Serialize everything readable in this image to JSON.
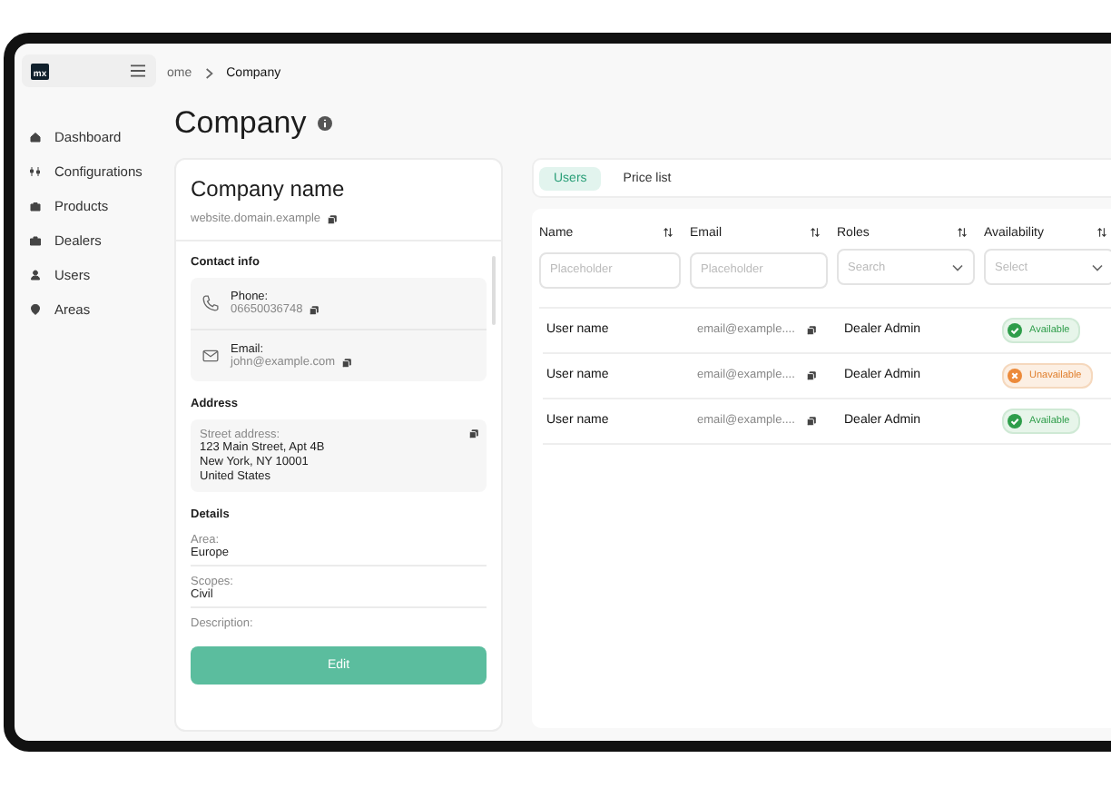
{
  "sidebar": {
    "logo": "mx",
    "items": [
      {
        "label": "Dashboard",
        "kind": "home"
      },
      {
        "label": "Configurations",
        "kind": "sliders"
      },
      {
        "label": "Products",
        "kind": "bag"
      },
      {
        "label": "Dealers",
        "kind": "briefcase"
      },
      {
        "label": "Users",
        "kind": "person"
      },
      {
        "label": "Areas",
        "kind": "pin"
      }
    ]
  },
  "breadcrumb": [
    "ome",
    "Company"
  ],
  "page_title": "Company",
  "company": {
    "name": "Company name",
    "website": "website.domain.example",
    "contact_title": "Contact info",
    "contacts": [
      {
        "kind": "phone",
        "label": "Phone:",
        "value": "06650036748"
      },
      {
        "kind": "email",
        "label": "Email:",
        "value": "john@example.com"
      }
    ],
    "address_title": "Address",
    "address_label": "Street address:",
    "address_lines": [
      "123 Main Street, Apt 4B",
      "New York, NY 10001",
      "United States"
    ],
    "details_title": "Details",
    "details": [
      {
        "label": "Area:",
        "value": "Europe"
      },
      {
        "label": "Scopes:",
        "value": "Civil"
      },
      {
        "label": "Description:"
      }
    ],
    "edit_button": "Edit"
  },
  "tabs": [
    {
      "label": "Users",
      "selected": true
    },
    {
      "label": "Price list",
      "selected": false
    }
  ],
  "table": {
    "columns": [
      {
        "label": "Name",
        "filter": {
          "kind": "text",
          "placeholder": "Placeholder"
        }
      },
      {
        "label": "Email",
        "filter": {
          "kind": "text",
          "placeholder": "Placeholder"
        }
      },
      {
        "label": "Roles",
        "filter": {
          "kind": "select",
          "placeholder": "Search"
        }
      },
      {
        "label": "Availability",
        "filter": {
          "kind": "select",
          "placeholder": "Select"
        }
      }
    ],
    "rows": [
      {
        "name": "User name",
        "email": "email@example....",
        "role": "Dealer Admin",
        "availability": {
          "kind": "available",
          "label": "Available"
        }
      },
      {
        "name": "User name",
        "email": "email@example....",
        "role": "Dealer Admin",
        "availability": {
          "kind": "unavailable",
          "label": "Unavailable"
        }
      },
      {
        "name": "User name",
        "email": "email@example....",
        "role": "Dealer Admin",
        "availability": {
          "kind": "available",
          "label": "Available"
        }
      }
    ]
  }
}
